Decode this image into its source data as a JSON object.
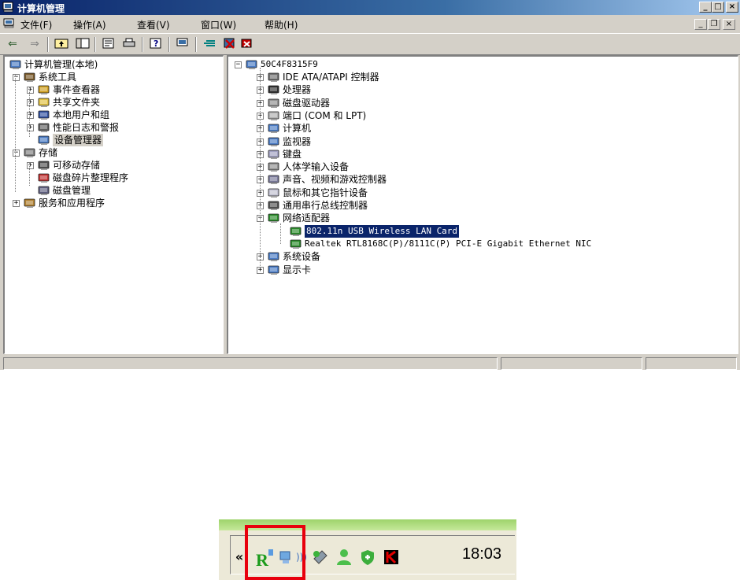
{
  "window": {
    "title": "计算机管理",
    "min_label": "_",
    "max_label": "□",
    "close_label": "×",
    "mdi_min": "_",
    "mdi_restore": "❐",
    "mdi_close": "×"
  },
  "menu": [
    "文件(F)",
    "操作(A)",
    "查看(V)",
    "窗口(W)",
    "帮助(H)"
  ],
  "toolbar_icons": [
    "back-arrow-icon",
    "forward-arrow-icon",
    "up-folder-icon",
    "show-tree-icon",
    "properties-icon",
    "print-icon",
    "help-icon",
    "device-manager-icon",
    "scan-hardware-icon",
    "disable-device-icon",
    "uninstall-device-icon"
  ],
  "left_tree": [
    {
      "label": "计算机管理(本地)",
      "level": 0,
      "icon": "computer-icon",
      "exp": ""
    },
    {
      "label": "系统工具",
      "level": 1,
      "icon": "tools-icon",
      "exp": "−"
    },
    {
      "label": "事件查看器",
      "level": 2,
      "icon": "event-viewer-icon",
      "exp": "+"
    },
    {
      "label": "共享文件夹",
      "level": 2,
      "icon": "shared-folder-icon",
      "exp": "+"
    },
    {
      "label": "本地用户和组",
      "level": 2,
      "icon": "users-icon",
      "exp": "+"
    },
    {
      "label": "性能日志和警报",
      "level": 2,
      "icon": "performance-icon",
      "exp": "+"
    },
    {
      "label": "设备管理器",
      "level": 2,
      "icon": "device-manager-icon",
      "exp": "",
      "highlight": true
    },
    {
      "label": "存储",
      "level": 1,
      "icon": "storage-icon",
      "exp": "−"
    },
    {
      "label": "可移动存储",
      "level": 2,
      "icon": "removable-storage-icon",
      "exp": "+"
    },
    {
      "label": "磁盘碎片整理程序",
      "level": 2,
      "icon": "defrag-icon",
      "exp": ""
    },
    {
      "label": "磁盘管理",
      "level": 2,
      "icon": "disk-management-icon",
      "exp": ""
    },
    {
      "label": "服务和应用程序",
      "level": 1,
      "icon": "services-icon",
      "exp": "+"
    }
  ],
  "right_tree": {
    "root": "50C4F8315F9",
    "items": [
      {
        "label": "IDE ATA/ATAPI 控制器",
        "icon": "ide-controller-icon",
        "exp": "+"
      },
      {
        "label": "处理器",
        "icon": "processor-icon",
        "exp": "+"
      },
      {
        "label": "磁盘驱动器",
        "icon": "disk-drive-icon",
        "exp": "+"
      },
      {
        "label": "端口 (COM 和 LPT)",
        "icon": "port-icon",
        "exp": "+"
      },
      {
        "label": "计算机",
        "icon": "computer-icon",
        "exp": "+"
      },
      {
        "label": "监视器",
        "icon": "monitor-icon",
        "exp": "+"
      },
      {
        "label": "键盘",
        "icon": "keyboard-icon",
        "exp": "+"
      },
      {
        "label": "人体学输入设备",
        "icon": "hid-icon",
        "exp": "+"
      },
      {
        "label": "声音、视频和游戏控制器",
        "icon": "sound-icon",
        "exp": "+"
      },
      {
        "label": "鼠标和其它指针设备",
        "icon": "mouse-icon",
        "exp": "+"
      },
      {
        "label": "通用串行总线控制器",
        "icon": "usb-icon",
        "exp": "+"
      },
      {
        "label": "网络适配器",
        "icon": "network-adapter-icon",
        "exp": "−"
      }
    ],
    "adapters": [
      {
        "label": "802.11n USB Wireless LAN Card",
        "icon": "network-card-icon",
        "selected": true
      },
      {
        "label": "Realtek RTL8168C(P)/8111C(P) PCI-E Gigabit Ethernet NIC",
        "icon": "network-card-icon",
        "selected": false
      }
    ],
    "tail": [
      {
        "label": "系统设备",
        "icon": "system-device-icon",
        "exp": "+"
      },
      {
        "label": "显示卡",
        "icon": "display-adapter-icon",
        "exp": "+"
      }
    ]
  },
  "tray": {
    "chevron": "«",
    "icons": [
      "realtek-utility-icon",
      "network-connection-icon",
      "wireless-signal-icon",
      "usb-safely-remove-icon",
      "messenger-icon",
      "security-shield-icon",
      "kaspersky-icon"
    ],
    "clock": "18:03"
  }
}
